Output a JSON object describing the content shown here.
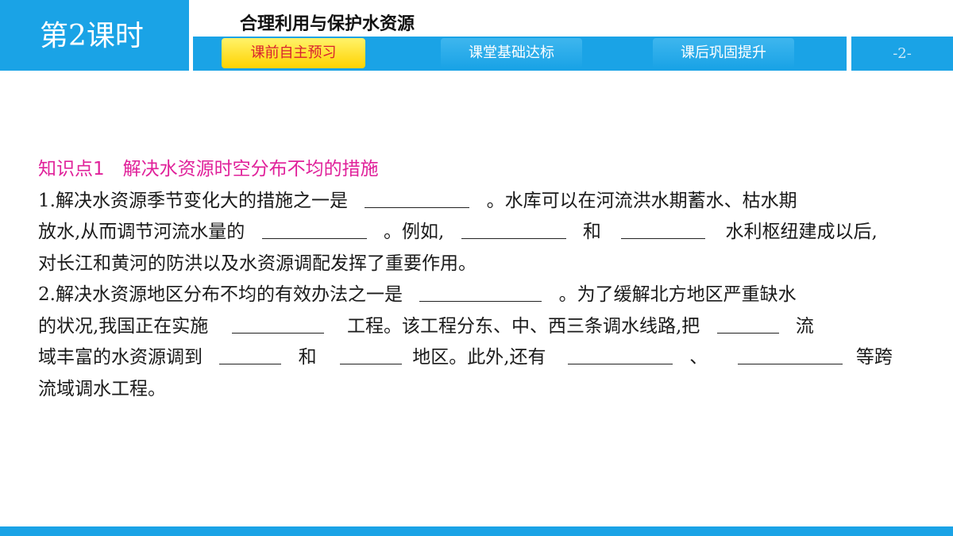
{
  "header": {
    "lesson": "第2课时",
    "topic": "合理利用与保护水资源",
    "page_number": "-2-",
    "tabs": [
      {
        "label": "课前自主预习",
        "active": true
      },
      {
        "label": "课堂基础达标",
        "active": false
      },
      {
        "label": "课后巩固提升",
        "active": false
      }
    ]
  },
  "colors": {
    "primary": "#1aa3e6",
    "active_tab": "#ffd200",
    "active_tab_text": "#d9212f",
    "heading": "#e0219a"
  },
  "content": {
    "heading": "知识点1　解决水资源时空分布不均的措施",
    "p1": {
      "a": "1.解决水资源季节变化大的措施之一是",
      "b": "。水库可以在河流洪水期蓄水、枯水期",
      "c": "放水,从而调节河流水量的",
      "d": "。例如,",
      "e": "和",
      "f": "水利枢纽建成以后,",
      "g": "对长江和黄河的防洪以及水资源调配发挥了重要作用。"
    },
    "p2": {
      "a": "2.解决水资源地区分布不均的有效办法之一是",
      "b": "。为了缓解北方地区严重缺水",
      "c": "的状况,我国正在实施",
      "d": "工程。该工程分东、中、西三条调水线路,把",
      "e": "流",
      "f": "域丰富的水资源调到",
      "g": "和",
      "h": "地区。此外,还有",
      "i": "、",
      "j": "等跨",
      "k": "流域调水工程。"
    }
  }
}
